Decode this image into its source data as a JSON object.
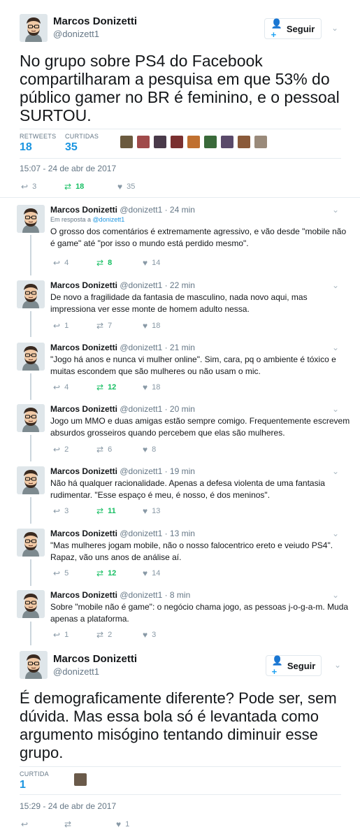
{
  "tweet1": {
    "name": "Marcos Donizetti",
    "handle": "@donizett1",
    "follow_label": "Seguir",
    "text": "No grupo sobre PS4 do Facebook compartilharam a pesquisa em que 53% do público gamer no BR é feminino, e o pessoal SURTOU.",
    "retweets_label": "RETWEETS",
    "retweets_value": "18",
    "likes_label": "CURTIDAS",
    "likes_value": "35",
    "timestamp": "15:07 - 24 de abr de 2017",
    "actions": {
      "reply": "3",
      "retweet": "18",
      "like": "35"
    }
  },
  "replies": [
    {
      "name": "Marcos Donizetti",
      "handle": "@donizett1",
      "time": "· 24 min",
      "in_reply_prefix": "Em resposta a",
      "in_reply_handle": "@donizett1",
      "text": "O grosso dos comentários é extremamente agressivo, e vão desde \"mobile não é game\" até \"por isso o mundo está perdido mesmo\".",
      "reply": "4",
      "retweet": "8",
      "like": "14"
    },
    {
      "name": "Marcos Donizetti",
      "handle": "@donizett1",
      "time": "· 22 min",
      "text": "De novo a fragilidade da fantasia de masculino, nada novo aqui, mas impressiona ver esse monte de homem adulto nessa.",
      "reply": "1",
      "retweet": "7",
      "like": "18"
    },
    {
      "name": "Marcos Donizetti",
      "handle": "@donizett1",
      "time": "· 21 min",
      "text": "\"Jogo há anos e nunca vi mulher online\". Sim, cara, pq o ambiente é tóxico e muitas escondem que são mulheres ou não usam o mic.",
      "reply": "4",
      "retweet": "12",
      "like": "18"
    },
    {
      "name": "Marcos Donizetti",
      "handle": "@donizett1",
      "time": "· 20 min",
      "text": "Jogo um MMO e duas amigas estão sempre comigo. Frequentemente escrevem absurdos grosseiros quando percebem que elas são mulheres.",
      "reply": "2",
      "retweet": "6",
      "like": "8"
    },
    {
      "name": "Marcos Donizetti",
      "handle": "@donizett1",
      "time": "· 19 min",
      "text": "Não há qualquer racionalidade. Apenas a defesa violenta de uma fantasia rudimentar. \"Esse espaço é meu, é nosso, é dos meninos\".",
      "reply": "3",
      "retweet": "11",
      "like": "13"
    },
    {
      "name": "Marcos Donizetti",
      "handle": "@donizett1",
      "time": "· 13 min",
      "text": "\"Mas mulheres jogam mobile, não o nosso falocentrico ereto e veiudo PS4\". Rapaz, vão uns anos de análise aí.",
      "reply": "5",
      "retweet": "12",
      "like": "14"
    },
    {
      "name": "Marcos Donizetti",
      "handle": "@donizett1",
      "time": "· 8 min",
      "text": "Sobre \"mobile não é game\": o negócio chama jogo, as pessoas j-o-g-a-m. Muda apenas a plataforma.",
      "reply": "1",
      "retweet": "2",
      "like": "3"
    }
  ],
  "tweet2": {
    "name": "Marcos Donizetti",
    "handle": "@donizett1",
    "follow_label": "Seguir",
    "text": "É demograficamente diferente? Pode ser, sem dúvida. Mas essa bola só é levantada como argumento misógino tentando diminuir esse grupo.",
    "likes_label": "CURTIDA",
    "likes_value": "1",
    "timestamp": "15:29 - 24 de abr de 2017",
    "actions": {
      "like": "1"
    }
  },
  "colors": {
    "accent": "#1da1f2",
    "stat_value": "#1b95e0",
    "retweet_on": "#17bf63",
    "muted": "#657786"
  },
  "icons": {
    "reply": "reply-icon",
    "retweet": "retweet-icon",
    "like": "heart-icon",
    "follow": "person-add-icon",
    "menu": "chevron-down-icon"
  }
}
